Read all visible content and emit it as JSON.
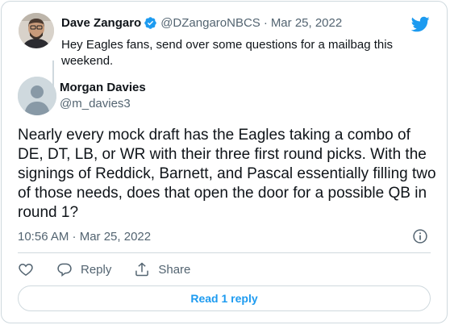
{
  "parent_tweet": {
    "author_name": "Dave Zangaro",
    "handle": "@DZangaroNBCS",
    "separator": "·",
    "date": "Mar 25, 2022",
    "text": "Hey Eagles fans, send over some questions for a mailbag this weekend."
  },
  "main_tweet": {
    "author_name": "Morgan Davies",
    "handle": "@m_davies3",
    "text": "Nearly every mock draft has the Eagles taking a combo of DE, DT, LB, or WR with their three first round picks. With the signings of Reddick, Barnett, and Pascal essentially filling two of those needs, does that open the door for a possible QB in round 1?",
    "timestamp": "10:56 AM · Mar 25, 2022"
  },
  "actions": {
    "reply_label": "Reply",
    "share_label": "Share"
  },
  "read_replies_label": "Read 1 reply",
  "colors": {
    "accent": "#1d9bf0",
    "text": "#0f1419",
    "muted": "#536471",
    "border": "#cfd9de"
  },
  "icons": [
    "verified-badge-icon",
    "twitter-bird-icon",
    "info-icon",
    "heart-icon",
    "reply-icon",
    "share-icon"
  ]
}
